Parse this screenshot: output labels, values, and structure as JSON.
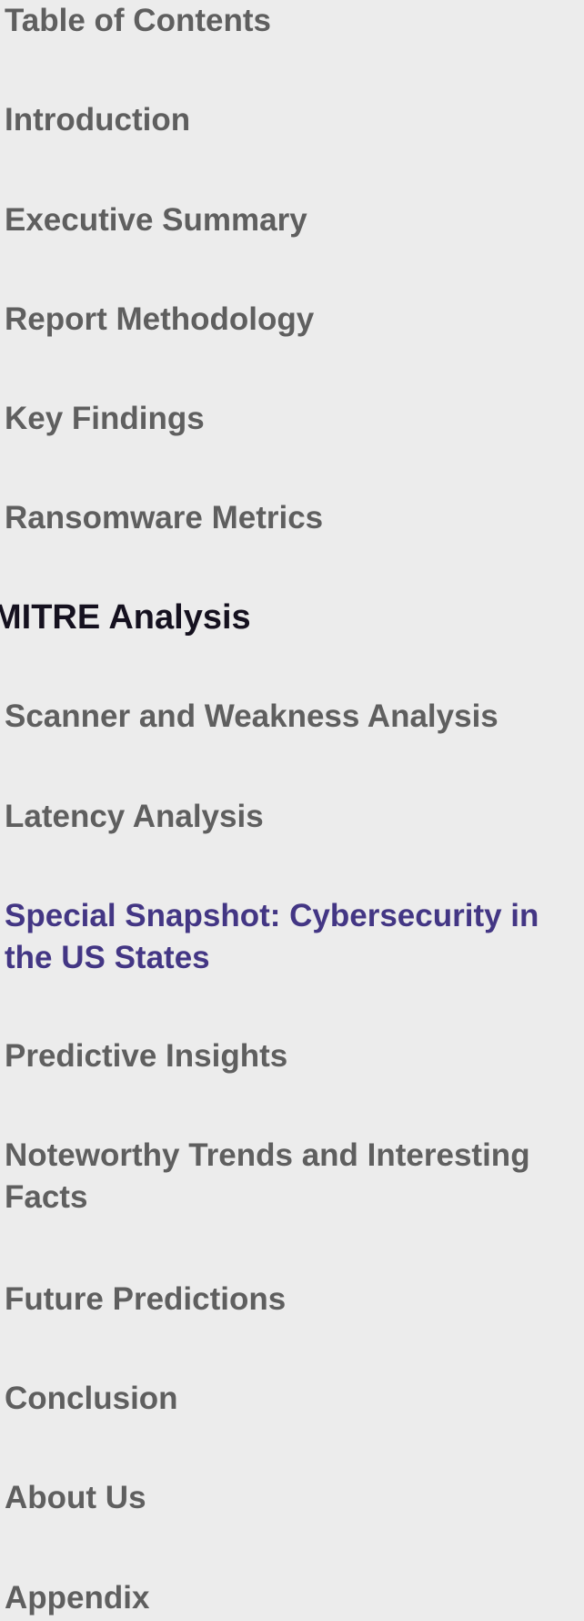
{
  "toc": {
    "title": "Table of Contents",
    "items": [
      {
        "label": "Introduction"
      },
      {
        "label": "Executive Summary"
      },
      {
        "label": "Report Methodology"
      },
      {
        "label": "Key Findings"
      },
      {
        "label": "Ransomware Metrics"
      },
      {
        "label": "MITRE Analysis",
        "state": "current"
      },
      {
        "label": "Scanner and Weakness Analysis"
      },
      {
        "label": "Latency Analysis"
      },
      {
        "label": "Special Snapshot: Cybersecurity in the US States",
        "state": "highlighted"
      },
      {
        "label": "Predictive Insights"
      },
      {
        "label": "Noteworthy Trends and Interesting Facts"
      },
      {
        "label": "Future Predictions"
      },
      {
        "label": "Conclusion"
      },
      {
        "label": "About Us"
      },
      {
        "label": "Appendix"
      }
    ]
  },
  "colors": {
    "background": "#ececec",
    "item_text": "#5f5f5f",
    "current_text": "#15111f",
    "highlight_text": "#433684"
  }
}
